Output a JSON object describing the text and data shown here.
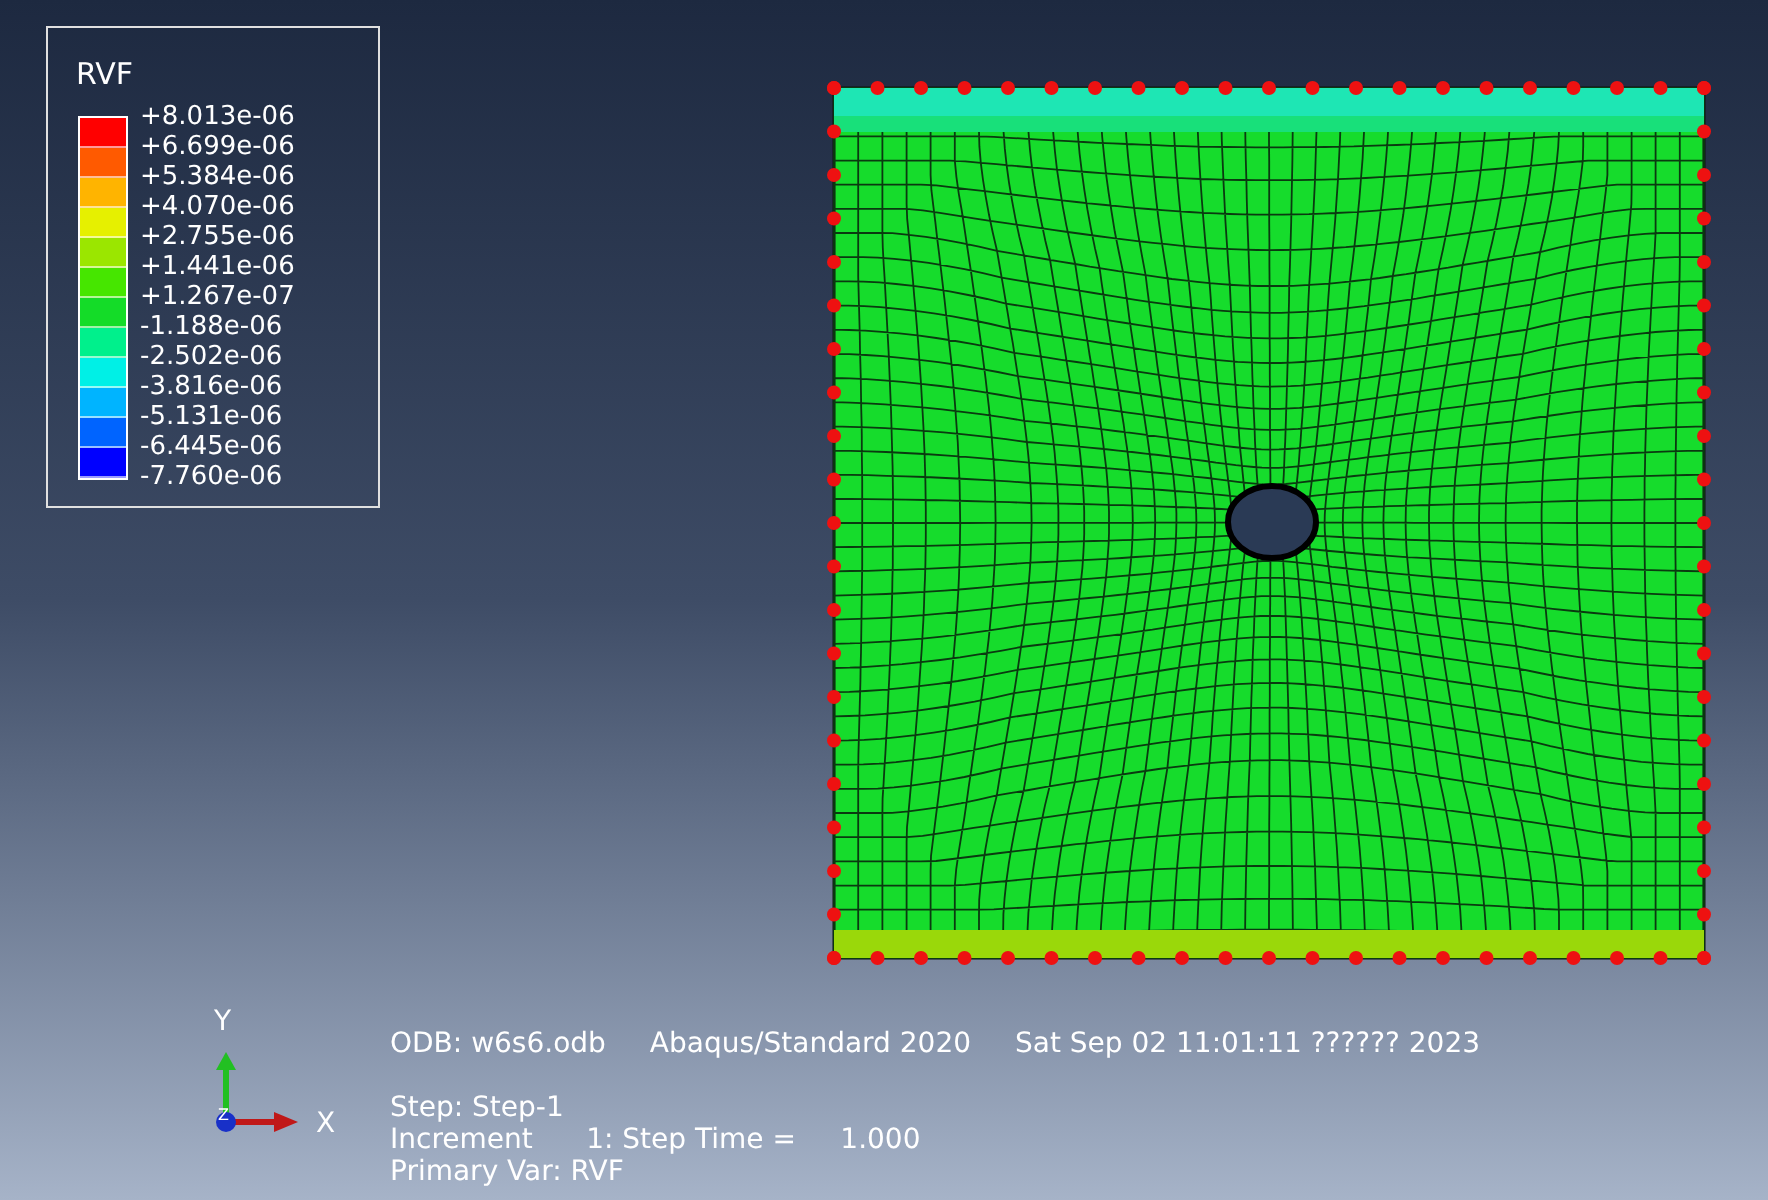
{
  "legend": {
    "title": "RVF",
    "bands": [
      {
        "color": "#ff0000"
      },
      {
        "color": "#ff5a00"
      },
      {
        "color": "#ffb400"
      },
      {
        "color": "#e6f000"
      },
      {
        "color": "#9be600"
      },
      {
        "color": "#46e600"
      },
      {
        "color": "#14dc28"
      },
      {
        "color": "#00f08c"
      },
      {
        "color": "#00f0e6"
      },
      {
        "color": "#00b4ff"
      },
      {
        "color": "#0064ff"
      },
      {
        "color": "#0000ff"
      }
    ],
    "labels": [
      "+8.013e-06",
      "+6.699e-06",
      "+5.384e-06",
      "+4.070e-06",
      "+2.755e-06",
      "+1.441e-06",
      "+1.267e-07",
      "-1.188e-06",
      "-2.502e-06",
      "-3.816e-06",
      "-5.131e-06",
      "-6.445e-06",
      "-7.760e-06"
    ]
  },
  "triad": {
    "y": "Y",
    "x": "X",
    "z": "Z"
  },
  "info": {
    "odb": "ODB: w6s6.odb",
    "solver": "Abaqus/Standard 2020",
    "date": "Sat Sep 02 11:01:11 ?????? 2023",
    "lines": [
      "Step: Step-1",
      "Increment      1: Step Time =     1.000",
      "Primary Var: RVF"
    ]
  }
}
